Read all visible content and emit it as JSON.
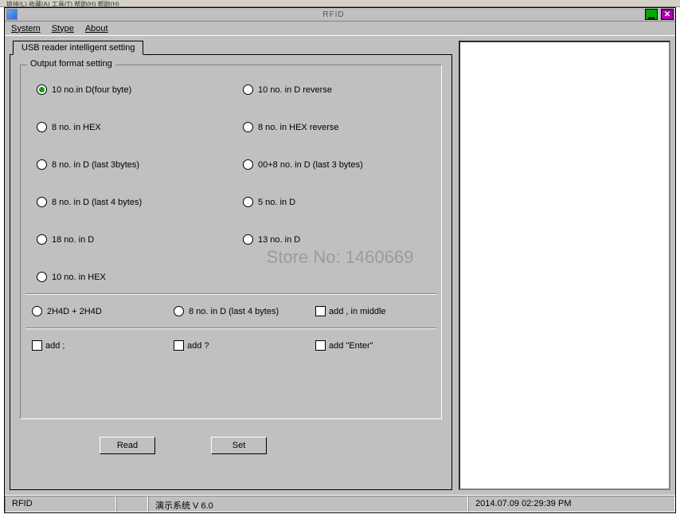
{
  "browser_top": "链接(L)  收藏(A)  工具(T)  帮助(H)  帮助(H)",
  "window": {
    "title": "RFID",
    "menu": [
      "System",
      "Stype",
      "About"
    ]
  },
  "tab_label": "USB reader intelligent setting",
  "groupbox_title": "Output format setting",
  "radios_col1": [
    "10 no.in D(four byte)",
    "8 no. in HEX",
    "8 no. in D (last 3bytes)",
    "8 no. in D (last 4 bytes)",
    "18 no. in D",
    "10 no. in HEX"
  ],
  "radios_col2": [
    "10 no. in D reverse",
    "8 no. in HEX reverse",
    "00+8 no. in D (last 3 bytes)",
    "5 no. in D",
    "13 no. in D"
  ],
  "selected_radio": "10 no.in D(four byte)",
  "row_middle": {
    "r1": "2H4D + 2H4D",
    "r2": "8 no. in D (last 4 bytes)",
    "c1": "add , in middle"
  },
  "row_bottom": {
    "c1": "add ;",
    "c2": "add ?",
    "c3": "add \"Enter\""
  },
  "buttons": {
    "read": "Read",
    "set": "Set"
  },
  "status": {
    "app": "RFID",
    "version": "演示系统  V 6.0",
    "datetime": "2014.07.09    02:29:39 PM"
  },
  "watermark": "Store No: 1460669"
}
